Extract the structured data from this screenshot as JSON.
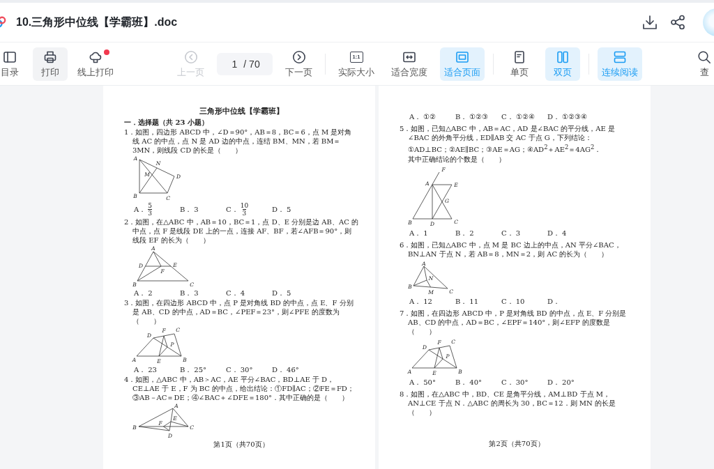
{
  "window": {
    "title": "10.三角形中位线【学霸班】.doc"
  },
  "toolbar": {
    "left": [
      {
        "kind": "button",
        "label": "目录",
        "selected": false,
        "hovered": false,
        "disabled": false,
        "notification": false
      },
      {
        "kind": "button",
        "label": "打印",
        "selected": false,
        "hovered": true,
        "disabled": false,
        "notification": false
      },
      {
        "kind": "button",
        "label": "线上打印",
        "selected": false,
        "hovered": false,
        "disabled": false,
        "notification": true
      }
    ],
    "groups": [
      [
        {
          "kind": "button",
          "label": "上一页",
          "selected": false,
          "hovered": false,
          "disabled": true,
          "notification": false
        },
        {
          "kind": "page-field",
          "value": "1",
          "total": "/ 70"
        },
        {
          "kind": "button",
          "label": "下一页",
          "selected": false,
          "hovered": false,
          "disabled": false,
          "notification": false
        }
      ],
      [
        {
          "kind": "button",
          "label": "实际大小",
          "icon_text": "1:1",
          "selected": false,
          "hovered": false,
          "disabled": false,
          "notification": false
        },
        {
          "kind": "button",
          "label": "适合宽度",
          "selected": false,
          "hovered": false,
          "disabled": false,
          "notification": false
        },
        {
          "kind": "button",
          "label": "适合页面",
          "selected": true,
          "hovered": false,
          "disabled": false,
          "notification": false
        }
      ],
      [
        {
          "kind": "button",
          "label": "单页",
          "selected": false,
          "hovered": false,
          "disabled": false,
          "notification": false
        },
        {
          "kind": "button",
          "label": "双页",
          "selected": true,
          "hovered": false,
          "disabled": false,
          "notification": false
        }
      ],
      [
        {
          "kind": "button",
          "label": "连续阅读",
          "selected": true,
          "hovered": false,
          "disabled": false,
          "notification": false
        }
      ]
    ],
    "right": [
      {
        "kind": "button",
        "label": "查",
        "selected": false,
        "hovered": false,
        "disabled": false,
        "notification": false
      }
    ]
  },
  "document": {
    "pages": [
      {
        "blocks": [
          {
            "kind": "title",
            "text": "三角形中位线【学霸班】"
          },
          {
            "kind": "section",
            "text": "一．选择题（共 23 小题）"
          },
          {
            "kind": "question",
            "text": "1．如图，四边形 ABCD 中，∠D＝90°，AB＝8，BC＝6，点 M 是对角线 AC 的中点，点 N 是 AD 边的中点，连结 BM、MN，若 BM＝3MN，则线段 CD 的长是（　　）"
          },
          {
            "kind": "figure",
            "labels": [
              "A",
              "N",
              "M",
              "D",
              "B",
              "C"
            ]
          },
          {
            "kind": "options",
            "items": [
              {
                "kind": "fraction",
                "label": "A．",
                "numerator": "5",
                "denominator": "3"
              },
              {
                "kind": "plain",
                "label": "B．",
                "value": "3"
              },
              {
                "kind": "fraction",
                "label": "C．",
                "numerator": "10",
                "denominator": "3"
              },
              {
                "kind": "plain",
                "label": "D．",
                "value": "5"
              }
            ]
          },
          {
            "kind": "question",
            "text": "2．如图，在△ABC 中，AB＝10，BC＝1，点 D、E 分别是边 AB、AC 的中点，点 F 是线段 DE 上的一点，连接 AF、BF，若∠AFB＝90°，则线段 EF 的长为（　　）"
          },
          {
            "kind": "figure",
            "labels": [
              "A",
              "D",
              "E",
              "F",
              "B",
              "C"
            ]
          },
          {
            "kind": "options",
            "items": [
              {
                "kind": "plain",
                "label": "A．",
                "value": "2"
              },
              {
                "kind": "plain",
                "label": "B．",
                "value": "3"
              },
              {
                "kind": "plain",
                "label": "C．",
                "value": "4"
              },
              {
                "kind": "plain",
                "label": "D．",
                "value": "5"
              }
            ]
          },
          {
            "kind": "question",
            "text": "3．如图，在四边形 ABCD 中，点 P 是对角线 BD 的中点，点 E、F 分别是 AB、CD 的中点，AD＝BC，∠PEF＝23°，则∠PFE 的度数为（　　）"
          },
          {
            "kind": "figure",
            "labels": [
              "D",
              "F",
              "C",
              "P",
              "A",
              "E",
              "B"
            ]
          },
          {
            "kind": "options",
            "items": [
              {
                "kind": "plain",
                "label": "A．",
                "value": "23"
              },
              {
                "kind": "plain",
                "label": "B．",
                "value": "25°"
              },
              {
                "kind": "plain",
                "label": "C．",
                "value": "30°"
              },
              {
                "kind": "plain",
                "label": "D．",
                "value": "46°"
              }
            ]
          },
          {
            "kind": "question",
            "text": "4．如图，△ABC 中，AB＞AC，AE 平分∠BAC，BD⊥AE 于 D，CE⊥AE 于 E，F 为 BC 的中点，给出结论：①FD∥AC；②FE＝FD；③AB－AC＝DE；④∠BAC＋∠DFE＝180°．其中正确的是（　　）"
          },
          {
            "kind": "figure",
            "labels": [
              "A",
              "E",
              "F",
              "B",
              "C",
              "D"
            ]
          },
          {
            "kind": "footer",
            "text": "第1页（共70页）"
          }
        ]
      },
      {
        "blocks": [
          {
            "kind": "options",
            "items": [
              {
                "kind": "plain",
                "label": "A．",
                "value": "①②"
              },
              {
                "kind": "plain",
                "label": "B．",
                "value": "①②③"
              },
              {
                "kind": "plain",
                "label": "C．",
                "value": "①②④"
              },
              {
                "kind": "plain",
                "label": "D．",
                "value": "①②③④"
              }
            ]
          },
          {
            "kind": "question",
            "text": "5．如图，已知△ABC 中，AB＝AC，AD 是∠BAC 的平分线，AE 是∠BAC 的外角平分线，ED∥AB 交 AC 于点 G，下列结论："
          },
          {
            "kind": "line",
            "text": "①AD⊥BC；②AE∥BC；③AE＝AG；④AD$^{2}$＋AE$^{2}$＝4AG$^{2}$．"
          },
          {
            "kind": "line",
            "text": "其中正确结论的个数是（　　）"
          },
          {
            "kind": "figure",
            "labels": [
              "F",
              "A",
              "E",
              "G",
              "B",
              "D",
              "C"
            ]
          },
          {
            "kind": "options",
            "items": [
              {
                "kind": "plain",
                "label": "A．",
                "value": "1"
              },
              {
                "kind": "plain",
                "label": "B．",
                "value": "2"
              },
              {
                "kind": "plain",
                "label": "C．",
                "value": "3"
              },
              {
                "kind": "plain",
                "label": "D．",
                "value": "4"
              }
            ]
          },
          {
            "kind": "question",
            "text": "6．如图，已知△ABC 中，点 M 是 BC 边上的中点，AN 平分∠BAC，BN⊥AN 于点 N，若 AB＝8，MN＝2，则 AC 的长为（　　）"
          },
          {
            "kind": "figure",
            "labels": [
              "A",
              "N",
              "B",
              "M",
              "C"
            ]
          },
          {
            "kind": "options",
            "items": [
              {
                "kind": "plain",
                "label": "A．",
                "value": "12"
              },
              {
                "kind": "plain",
                "label": "B．",
                "value": "11"
              },
              {
                "kind": "plain",
                "label": "C．",
                "value": "10"
              },
              {
                "kind": "plain",
                "label": "D．"
              }
            ]
          },
          {
            "kind": "question",
            "text": "7．如图，在四边形 ABCD 中，P 是对角线 BD 的中点，点 E、F 分别是 AB、CD 的中点，AD＝BC，∠EPF＝140°，则∠EFP 的度数是（　　）"
          },
          {
            "kind": "figure",
            "labels": [
              "D",
              "F",
              "C",
              "P",
              "A",
              "E",
              "B"
            ]
          },
          {
            "kind": "options",
            "items": [
              {
                "kind": "plain",
                "label": "A．",
                "value": "50°"
              },
              {
                "kind": "plain",
                "label": "B．",
                "value": "40°"
              },
              {
                "kind": "plain",
                "label": "C．",
                "value": "30°"
              },
              {
                "kind": "plain",
                "label": "D．",
                "value": "20°"
              }
            ]
          },
          {
            "kind": "question",
            "text": "8．如图，在△ABC 中，BD、CE 是角平分线，AM⊥BD 于点 M，AN⊥CE 于点 N．△ABC 的周长为 30，BC＝12．则 MN 的长是（　　）"
          },
          {
            "kind": "footer",
            "text": "第2页（共70页）"
          }
        ]
      }
    ]
  }
}
